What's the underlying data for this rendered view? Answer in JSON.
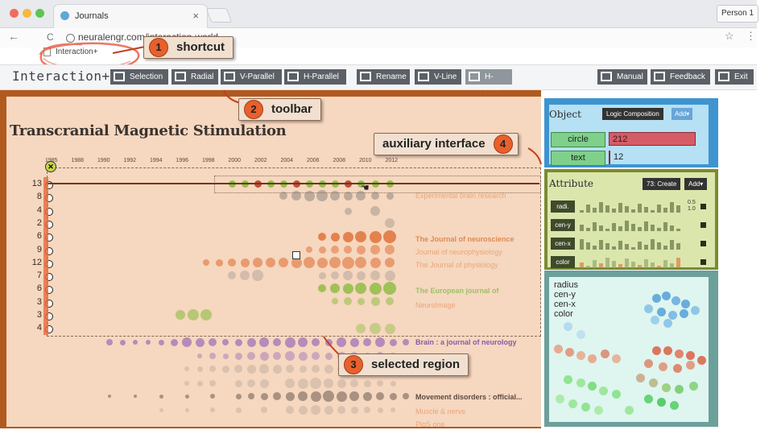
{
  "browser": {
    "tab_title": "Journals",
    "tab_close": "×",
    "url": "neuralengr.com/interaction-world",
    "bookmark": "Interaction+",
    "profile": "Person 1",
    "nav_back": "←",
    "nav_reload": "C",
    "star": "☆",
    "menu": "⋮"
  },
  "app": {
    "brand": "Interaction+",
    "tools": [
      {
        "label": "Selection",
        "icon": "selection-rect-icon"
      },
      {
        "label": "Radial",
        "icon": "radial-icon"
      },
      {
        "label": "V-Parallel",
        "icon": "v-parallel-icon"
      },
      {
        "label": "H-Parallel",
        "icon": "h-parallel-icon"
      },
      {
        "label": "Rename",
        "icon": "pointer-icon"
      },
      {
        "label": "V-Line",
        "icon": "v-line-icon"
      },
      {
        "label": "H-Line",
        "icon": "h-line-icon"
      }
    ],
    "right_tools": [
      {
        "label": "Manual",
        "icon": "manual-icon"
      },
      {
        "label": "Feedback",
        "icon": "feedback-icon"
      },
      {
        "label": "Exit",
        "icon": "exit-icon"
      }
    ]
  },
  "visualization": {
    "title": "Transcranial Magnetic Stimulation",
    "years": [
      "1985",
      "1988",
      "1990",
      "1992",
      "1994",
      "1996",
      "1998",
      "2000",
      "2002",
      "2004",
      "2006",
      "2008",
      "2010",
      "2012"
    ],
    "row_counts": [
      "13",
      "8",
      "4",
      "2",
      "6",
      "9",
      "12",
      "7",
      "6",
      "3",
      "3",
      "4"
    ],
    "journals": [
      {
        "name": "Experimental brain research",
        "style": "faint"
      },
      {
        "name": "The Journal of neuroscience",
        "style": "orange"
      },
      {
        "name": "Journal of neurophysiology",
        "style": "faint"
      },
      {
        "name": "The Journal of physiology",
        "style": "faint"
      },
      {
        "name": "The European journal of",
        "style": "green"
      },
      {
        "name": "NeuroImage",
        "style": "faint"
      },
      {
        "name": "Brain : a journal of neurology",
        "style": "purple"
      },
      {
        "name": "Movement disorders : official...",
        "style": "dark"
      },
      {
        "name": "Muscle & nerve",
        "style": "faint"
      },
      {
        "name": "PloS one",
        "style": "faint"
      }
    ]
  },
  "callouts": [
    {
      "num": "1",
      "text": "shortcut"
    },
    {
      "num": "2",
      "text": "toolbar"
    },
    {
      "num": "3",
      "text": "selected region"
    },
    {
      "num": "4",
      "text": "auxiliary interface"
    }
  ],
  "object_panel": {
    "title": "Object",
    "logic_btn": "Logic Composition",
    "add_btn": "Add▾",
    "rows": [
      {
        "label": "circle",
        "value": "212"
      },
      {
        "label": "text",
        "value": "12"
      }
    ]
  },
  "attribute_panel": {
    "title": "Attribute",
    "create_btn": "73: Create",
    "add_btn": "Add▾",
    "attrs": [
      "radi.",
      "cen-y",
      "cen-x",
      "color"
    ],
    "range_top": "0.5",
    "range_bottom": "1.0"
  },
  "scatter_panel": {
    "legend": [
      "radius",
      "cen-y",
      "cen-x",
      "color"
    ]
  },
  "colors": {
    "accent": "#e8602c",
    "toolbar_btn": "#5b6066",
    "orange_bubble": "#e0733a",
    "green_bubble": "#8fbd45",
    "gray_bubble": "#a89c92",
    "purple_bubble": "#9b6bb8",
    "dark_bubble": "#6a5a4e"
  }
}
